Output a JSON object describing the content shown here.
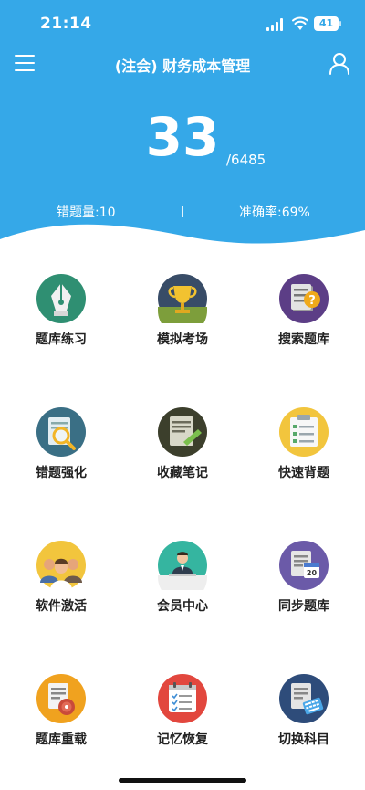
{
  "status_bar": {
    "time": "21:14",
    "battery": "41"
  },
  "header": {
    "title": "(注会) 财务成本管理",
    "done_count": "33",
    "total_count": "/6485",
    "wrong_count": "错题量:10",
    "accuracy": "准确率:69%"
  },
  "colors": {
    "primary": "#35a8e8"
  },
  "menu": [
    {
      "label": "题库练习",
      "icon": "fountain-pen-icon"
    },
    {
      "label": "模拟考场",
      "icon": "trophy-icon"
    },
    {
      "label": "搜索题库",
      "icon": "search-document-icon"
    },
    {
      "label": "错题强化",
      "icon": "magnifier-document-icon"
    },
    {
      "label": "收藏笔记",
      "icon": "notebook-pen-icon"
    },
    {
      "label": "快速背题",
      "icon": "checklist-icon"
    },
    {
      "label": "软件激活",
      "icon": "users-icon"
    },
    {
      "label": "会员中心",
      "icon": "member-icon"
    },
    {
      "label": "同步题库",
      "icon": "calendar-sync-icon"
    },
    {
      "label": "题库重载",
      "icon": "reload-target-icon"
    },
    {
      "label": "记忆恢复",
      "icon": "memory-calendar-icon"
    },
    {
      "label": "切换科目",
      "icon": "switch-subject-icon"
    }
  ]
}
